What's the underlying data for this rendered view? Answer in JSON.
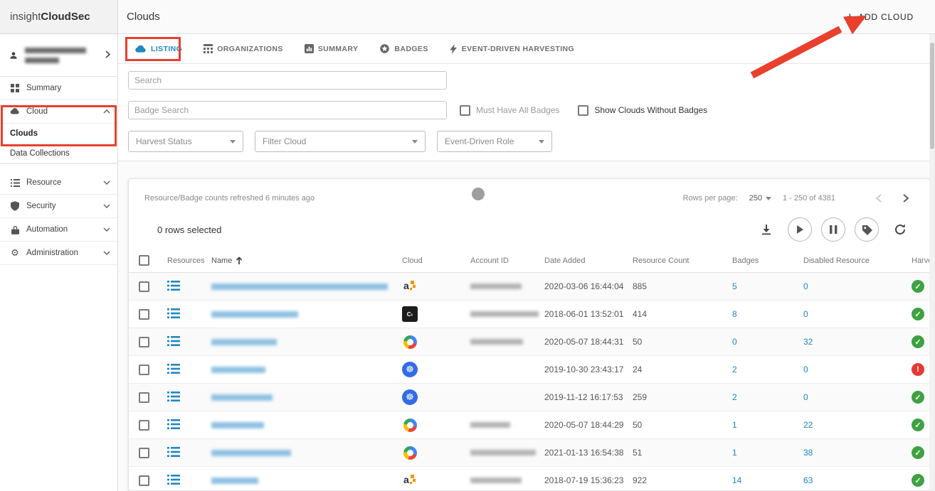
{
  "brand": {
    "logo_prefix": "insight",
    "logo_suffix": "CloudSec"
  },
  "sidebar": {
    "items": [
      {
        "label": "Summary"
      },
      {
        "label": "Cloud"
      },
      {
        "label": "Clouds"
      },
      {
        "label": "Data Collections"
      },
      {
        "label": "Resource"
      },
      {
        "label": "Security"
      },
      {
        "label": "Automation"
      },
      {
        "label": "Administration"
      }
    ]
  },
  "header": {
    "title": "Clouds",
    "add_button_label": "ADD CLOUD"
  },
  "tabs": [
    {
      "label": "LISTING",
      "active": true
    },
    {
      "label": "ORGANIZATIONS"
    },
    {
      "label": "SUMMARY"
    },
    {
      "label": "BADGES"
    },
    {
      "label": "EVENT-DRIVEN HARVESTING"
    }
  ],
  "filters": {
    "search_placeholder": "Search",
    "badge_search_placeholder": "Badge Search",
    "must_have_all_badges_label": "Must Have All Badges",
    "show_without_badges_label": "Show Clouds Without Badges",
    "harvest_status_label": "Harvest Status",
    "filter_cloud_label": "Filter Cloud",
    "event_driven_role_label": "Event-Driven Role"
  },
  "table": {
    "refresh_note": "Resource/Badge counts refreshed 6 minutes ago",
    "rows_per_page_label": "Rows per page:",
    "rows_per_page_value": "250",
    "range_label": "1 - 250 of 4381",
    "selected_label": "0 rows selected",
    "columns": [
      "Resources",
      "Name",
      "Cloud",
      "Account ID",
      "Date Added",
      "Resource Count",
      "Badges",
      "Disabled Resource",
      "Harvest"
    ],
    "rows": [
      {
        "provider": "aws",
        "name_w": 248,
        "account_w": 72,
        "date": "2020-03-06 16:44:04",
        "count": "885",
        "badges": "5",
        "disabled": "0",
        "status": "ok"
      },
      {
        "provider": "custom",
        "name_w": 122,
        "account_w": 96,
        "date": "2018-06-01 13:52:01",
        "count": "414",
        "badges": "8",
        "disabled": "0",
        "status": "ok"
      },
      {
        "provider": "gcp",
        "name_w": 92,
        "account_w": 74,
        "date": "2020-05-07 18:44:31",
        "count": "50",
        "badges": "0",
        "disabled": "32",
        "status": "ok"
      },
      {
        "provider": "k8s",
        "name_w": 76,
        "account_w": 0,
        "date": "2019-10-30 23:43:17",
        "count": "24",
        "badges": "2",
        "disabled": "0",
        "status": "error"
      },
      {
        "provider": "k8s",
        "name_w": 86,
        "account_w": 0,
        "date": "2019-11-12 16:17:53",
        "count": "259",
        "badges": "2",
        "disabled": "0",
        "status": "ok"
      },
      {
        "provider": "gcp",
        "name_w": 74,
        "account_w": 56,
        "date": "2020-05-07 18:44:29",
        "count": "50",
        "badges": "1",
        "disabled": "22",
        "status": "ok"
      },
      {
        "provider": "gcp",
        "name_w": 112,
        "account_w": 92,
        "date": "2021-01-13 16:54:38",
        "count": "51",
        "badges": "1",
        "disabled": "38",
        "status": "ok"
      },
      {
        "provider": "aws",
        "name_w": 66,
        "account_w": 72,
        "date": "2018-07-19 15:36:23",
        "count": "922",
        "badges": "14",
        "disabled": "63",
        "status": "ok"
      }
    ]
  },
  "annotations": {
    "color": "#e8402c",
    "targets": [
      "listing-tab",
      "cloud-nav-group",
      "add-cloud-button"
    ]
  }
}
